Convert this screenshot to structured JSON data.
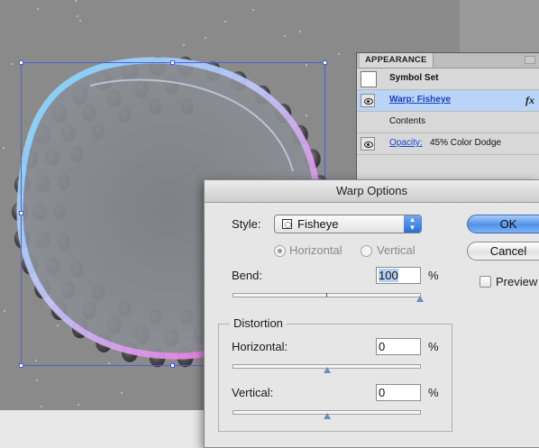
{
  "appearance": {
    "tab_label": "APPEARANCE",
    "rows": [
      {
        "label": "Symbol Set"
      },
      {
        "label": "Warp: Fisheye",
        "fx": "fx"
      },
      {
        "label": "Contents"
      },
      {
        "label": "Opacity:",
        "value": "45% Color Dodge"
      }
    ]
  },
  "dialog": {
    "title": "Warp Options",
    "style_label": "Style:",
    "style_value": "Fisheye",
    "orientation": {
      "horizontal": "Horizontal",
      "vertical": "Vertical",
      "selected": "horizontal"
    },
    "bend": {
      "label": "Bend:",
      "value": "100",
      "unit": "%",
      "slider_fraction": 1.0
    },
    "distortion": {
      "title": "Distortion",
      "horizontal": {
        "label": "Horizontal:",
        "value": "0",
        "unit": "%",
        "slider_fraction": 0.5
      },
      "vertical": {
        "label": "Vertical:",
        "value": "0",
        "unit": "%",
        "slider_fraction": 0.5
      }
    },
    "ok_label": "OK",
    "cancel_label": "Cancel",
    "preview_label": "Preview",
    "preview_checked": false
  },
  "icons": [
    "eye-icon",
    "fx-icon",
    "style-warp-icon",
    "select-arrows-icon",
    "panel-menu-icon"
  ],
  "colors": {
    "selection": "#4a62d8",
    "highlight_row": "#bad4f7",
    "ok_button": "#4f92ea"
  }
}
